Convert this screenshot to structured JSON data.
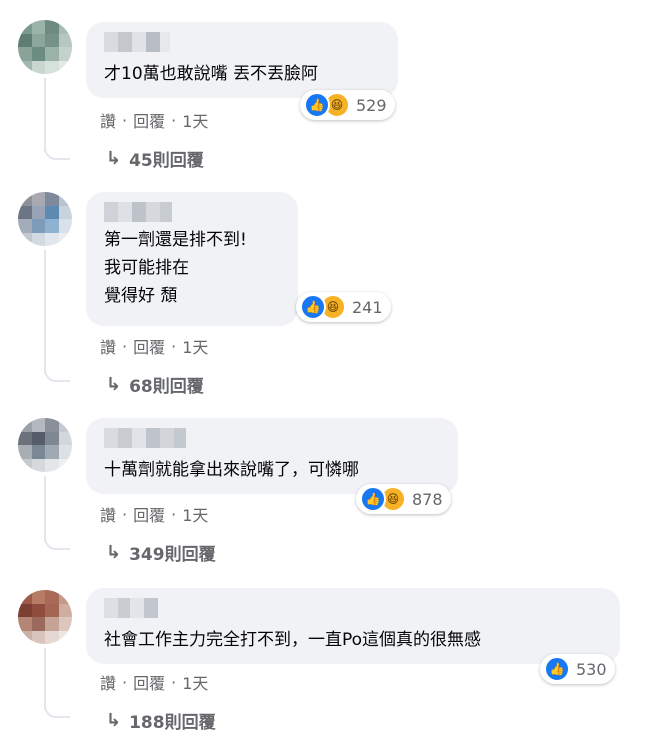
{
  "comments": [
    {
      "lines": [
        "才10萬也敢說嘴 丟不丟臉阿"
      ],
      "reaction_count": "529",
      "actions": {
        "like": "讚",
        "reply": "回覆",
        "time": "1天"
      },
      "replies_label": "45則回覆",
      "reactions": [
        "like",
        "haha"
      ]
    },
    {
      "lines": [
        "第一劑還是排不到!",
        "我可能排在",
        "覺得好 頹"
      ],
      "reaction_count": "241",
      "actions": {
        "like": "讚",
        "reply": "回覆",
        "time": "1天"
      },
      "replies_label": "68則回覆",
      "reactions": [
        "like",
        "haha"
      ]
    },
    {
      "lines": [
        "十萬劑就能拿出來說嘴了，可憐哪"
      ],
      "reaction_count": "878",
      "actions": {
        "like": "讚",
        "reply": "回覆",
        "time": "1天"
      },
      "replies_label": "349則回覆",
      "reactions": [
        "like",
        "haha"
      ]
    },
    {
      "lines": [
        "社會工作主力完全打不到，一直Po這個真的很無感"
      ],
      "reaction_count": "530",
      "actions": {
        "like": "讚",
        "reply": "回覆",
        "time": "1天"
      },
      "replies_label": "188則回覆",
      "reactions": [
        "like"
      ]
    }
  ],
  "separator": "·",
  "icons": {
    "like": "thumbs-up-icon",
    "haha": "laughing-face-icon",
    "reply_arrow": "reply-arrow-icon"
  },
  "colors": {
    "bubble": "#f0f2f5",
    "like_blue": "#1877f2",
    "haha_yellow": "#f7b125",
    "meta_gray": "#65676b"
  }
}
